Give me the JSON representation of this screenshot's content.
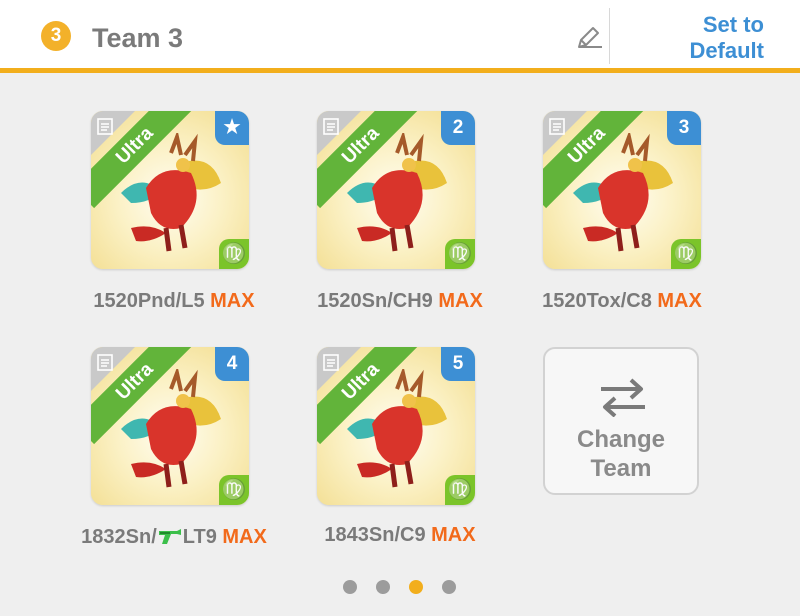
{
  "header": {
    "team_number": "3",
    "title": "Team 3",
    "default_button": "Set to Default"
  },
  "cards": [
    {
      "rarity": "Ultra",
      "slot": "★",
      "element_symbol": "♍",
      "name": "1520Pnd/L5",
      "level_tag": "MAX"
    },
    {
      "rarity": "Ultra",
      "slot": "2",
      "element_symbol": "♍",
      "name": "1520Sn/CH9",
      "level_tag": "MAX"
    },
    {
      "rarity": "Ultra",
      "slot": "3",
      "element_symbol": "♍",
      "name": "1520Tox/C8",
      "level_tag": "MAX"
    },
    {
      "rarity": "Ultra",
      "slot": "4",
      "element_symbol": "♍",
      "name_prefix": "1832Sn/",
      "name_suffix": "LT9",
      "level_tag": "MAX"
    },
    {
      "rarity": "Ultra",
      "slot": "5",
      "element_symbol": "♍",
      "name": "1843Sn/C9",
      "level_tag": "MAX"
    }
  ],
  "change_team": {
    "label": "Change Team"
  },
  "pagination": {
    "pages": 4,
    "current": 3
  },
  "colors": {
    "accent": "#f2ae1c",
    "ultra_green": "#62b43a",
    "slot_blue": "#3d8fd4",
    "max_orange": "#f26a1b"
  }
}
